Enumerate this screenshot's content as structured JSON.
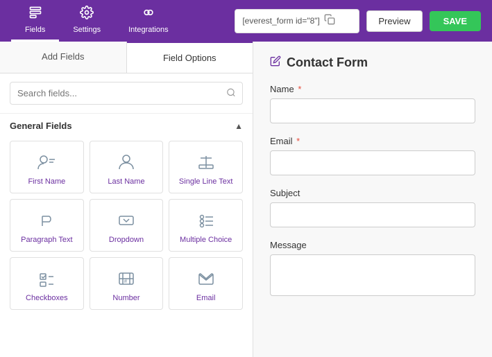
{
  "nav": {
    "items": [
      {
        "label": "Fields",
        "icon": "📄",
        "active": true
      },
      {
        "label": "Settings",
        "icon": "🔧",
        "active": false
      },
      {
        "label": "Integrations",
        "icon": "🔗",
        "active": false
      }
    ],
    "shortcode": "[everest_form id=\"8\"]",
    "preview_label": "Preview",
    "save_label": "SAVE"
  },
  "left_panel": {
    "tabs": [
      {
        "label": "Add Fields",
        "active": false
      },
      {
        "label": "Field Options",
        "active": true
      }
    ],
    "search_placeholder": "Search fields...",
    "section_label": "General Fields",
    "fields": [
      {
        "label": "First Name",
        "icon": "first-name"
      },
      {
        "label": "Last Name",
        "icon": "last-name"
      },
      {
        "label": "Single Line Text",
        "icon": "single-line"
      },
      {
        "label": "Paragraph Text",
        "icon": "paragraph"
      },
      {
        "label": "Dropdown",
        "icon": "dropdown"
      },
      {
        "label": "Multiple Choice",
        "icon": "multiple-choice"
      },
      {
        "label": "Checkboxes",
        "icon": "checkboxes"
      },
      {
        "label": "Number",
        "icon": "number"
      },
      {
        "label": "Email",
        "icon": "email"
      }
    ]
  },
  "right_panel": {
    "form_title": "Contact Form",
    "edit_icon": "✏️",
    "fields": [
      {
        "label": "Name",
        "required": true,
        "type": "input"
      },
      {
        "label": "Email",
        "required": true,
        "type": "input"
      },
      {
        "label": "Subject",
        "required": false,
        "type": "input"
      },
      {
        "label": "Message",
        "required": false,
        "type": "textarea"
      }
    ]
  }
}
